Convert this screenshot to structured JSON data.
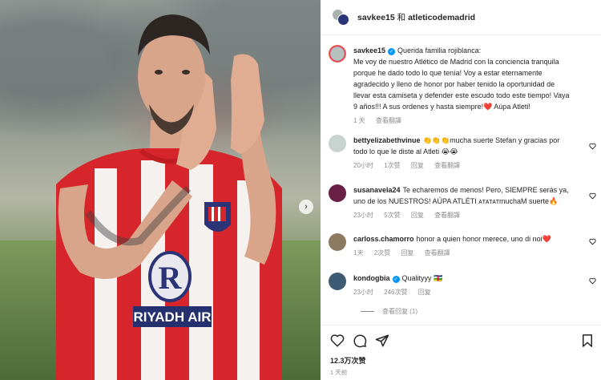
{
  "header": {
    "author": "savkee15",
    "separator": "和",
    "collaborator": "atleticodemadrid"
  },
  "caption": {
    "author": "savkee15",
    "text": "Querida familia rojiblanca:\nMe voy de nuestro Atlético de Madrid con la conciencia tranquila porque he dado todo lo que tenía! Voy a estar eternamente agradecido y lleno de honor por haber tenido la oportunidad de llevar esta camiseta y defender este escudo todo este tiempo! Vaya 9 años!!! A sus ordenes y hasta siempre!❤️ Aúpa Atleti!",
    "time": "1 天",
    "translate": "查看翻譯"
  },
  "comments": [
    {
      "user": "bettyelizabethvinue",
      "text": "👏👏👏mucha suerte Stefan y gracias por todo lo que le diste al Atleti 😭😭",
      "time": "20小时",
      "likes": "1次赞",
      "reply": "回复",
      "translate": "查看翻譯",
      "avatar_color": "#c9d3d0"
    },
    {
      "user": "susanavela24",
      "text": "Te echaremos de menos! Pero, SIEMPRE serás ya, uno de los NUESTROS! AÚPA ATLÉTI ᴀᴛᴀᴛᴀᴛmuchaM suerte🔥",
      "time": "23小时",
      "likes": "5次赞",
      "reply": "回复",
      "translate": "查看翻譯",
      "avatar_color": "#6a1f44"
    },
    {
      "user": "carloss.chamorro",
      "text": "honor a quien honor merece, uno di noi❤️",
      "time": "1天",
      "likes": "2次赞",
      "reply": "回复",
      "translate": "查看翻譯",
      "avatar_color": "#8b7a60"
    },
    {
      "user": "kondogbia",
      "text": "Qualityyy 🇨🇫",
      "time": "23小时",
      "likes": "246次赞",
      "reply": "回复",
      "translate": "",
      "avatar_color": "#3f5b73"
    }
  ],
  "view_replies": "查看回复 (1)",
  "likes_count": "12.3万次赞",
  "post_date": "1 天前",
  "colors": {
    "verified": "#0095f6",
    "jersey_red": "#d7262b",
    "secondary_text": "#8e8e8e"
  },
  "icons": [
    "heart-icon",
    "comment-icon",
    "share-icon",
    "bookmark-icon",
    "chevron-right-icon"
  ]
}
